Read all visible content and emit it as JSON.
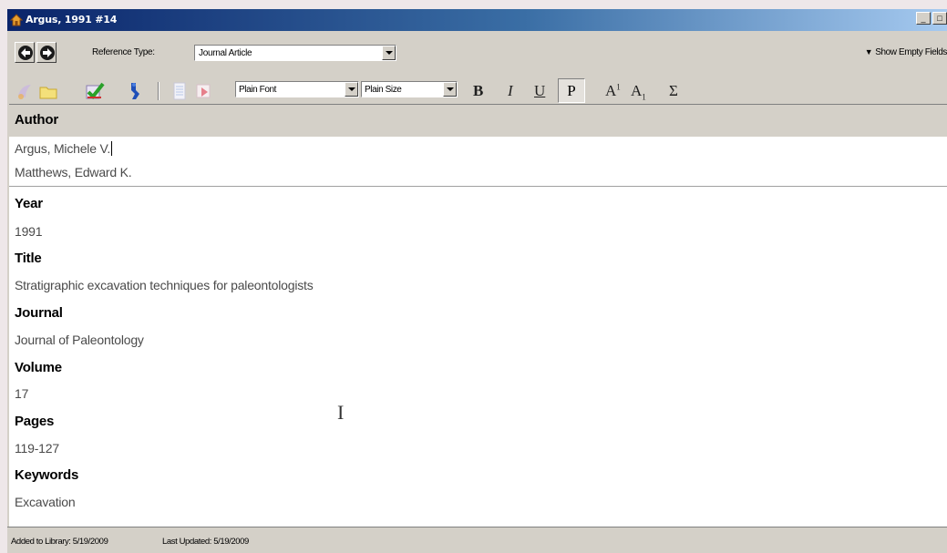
{
  "window": {
    "title": "Argus, 1991 #14",
    "controls": {
      "minimize": "_",
      "maximize": "□",
      "close": "×"
    }
  },
  "toolbar": {
    "reference_type_label": "Reference Type:",
    "reference_type_value": "Journal Article",
    "show_empty_fields": "Show Empty Fields",
    "font_value": "Plain Font",
    "size_value": "Plain Size",
    "format_buttons": {
      "bold": "B",
      "italic": "I",
      "underline": "U",
      "plain": "P",
      "superscript": "A",
      "superscript_mark": "1",
      "subscript": "A",
      "subscript_mark": "1",
      "symbol": "Σ"
    }
  },
  "record": {
    "author": {
      "label": "Author",
      "values": [
        "Argus, Michele V.",
        "Matthews, Edward K."
      ]
    },
    "year": {
      "label": "Year",
      "value": "1991"
    },
    "title": {
      "label": "Title",
      "value": "Stratigraphic excavation techniques for paleontologists"
    },
    "journal": {
      "label": "Journal",
      "value": "Journal of Paleontology"
    },
    "volume": {
      "label": "Volume",
      "value": "17"
    },
    "pages": {
      "label": "Pages",
      "value": "119-127"
    },
    "keywords": {
      "label": "Keywords",
      "value": "Excavation"
    }
  },
  "status": {
    "added": "Added to Library: 5/19/2009",
    "updated": "Last Updated: 5/19/2009"
  },
  "icons": [
    "back-arrow-icon",
    "forward-arrow-icon",
    "insert-citation-icon",
    "open-folder-icon",
    "check-spelling-icon",
    "link-icon",
    "document-icon",
    "attach-file-icon",
    "text-cursor-icon"
  ]
}
